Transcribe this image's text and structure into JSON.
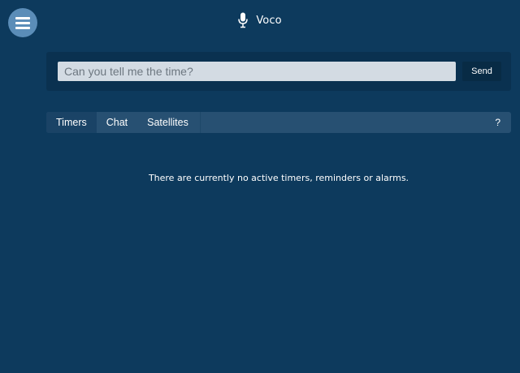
{
  "header": {
    "title": "Voco",
    "icon": "microphone-icon",
    "menu_icon": "hamburger-menu-icon"
  },
  "input": {
    "placeholder": "Can you tell me the time?",
    "value": "",
    "send_label": "Send"
  },
  "tabs": {
    "items": [
      {
        "label": "Timers",
        "active": true
      },
      {
        "label": "Chat",
        "active": false
      },
      {
        "label": "Satellites",
        "active": false
      }
    ],
    "help_label": "?"
  },
  "timers": {
    "empty_message": "There are currently no active timers, reminders or alarms."
  },
  "colors": {
    "background": "#0d3a5d",
    "menu_button": "#5b8db8",
    "input_panel": "#0a3150",
    "input_field": "#d3dbe3",
    "send_button": "#082b45",
    "tab_bar": "#275072",
    "tab_active": "#1a4366"
  }
}
